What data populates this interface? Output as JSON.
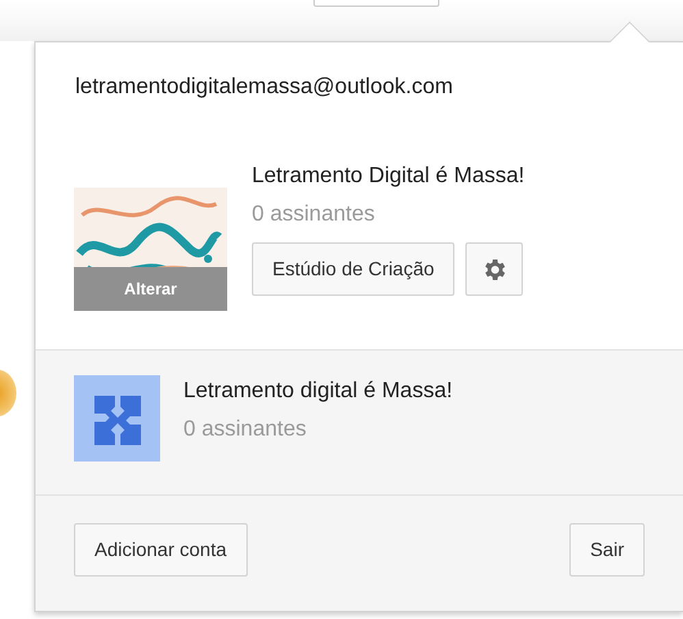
{
  "account": {
    "email": "letramentodigitalemassa@outlook.com"
  },
  "current_channel": {
    "name": "Letramento Digital é Massa!",
    "subscribers": "0 assinantes",
    "avatar_overlay": "Alterar",
    "studio_button": "Estúdio de Criação"
  },
  "other_channels": [
    {
      "name": "Letramento digital é Massa!",
      "subscribers": "0 assinantes"
    }
  ],
  "footer": {
    "add_account": "Adicionar conta",
    "sign_out": "Sair"
  }
}
